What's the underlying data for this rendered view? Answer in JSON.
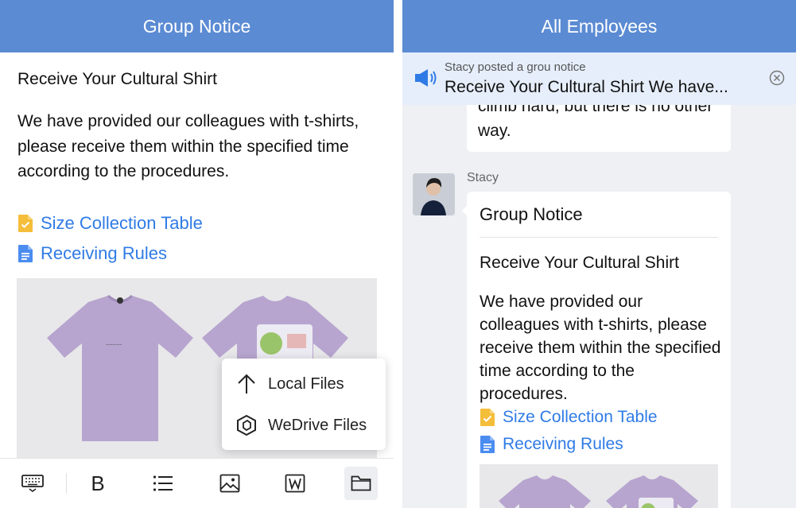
{
  "left": {
    "title": "Group Notice",
    "notice_title": "Receive Your Cultural Shirt",
    "notice_body": "We have provided our colleagues with t-shirts, please receive them within the specified time according to the procedures.",
    "links": [
      {
        "label": "Size Collection Table",
        "icon": "sheet-doc-icon"
      },
      {
        "label": "Receiving Rules",
        "icon": "text-doc-icon"
      }
    ],
    "upload_menu": {
      "items": [
        {
          "label": "Local Files",
          "icon": "upload-arrow-icon"
        },
        {
          "label": "WeDrive Files",
          "icon": "wedrive-icon"
        }
      ]
    },
    "toolbar": {
      "items": [
        "keyboard-icon",
        "bold-icon",
        "list-icon",
        "image-icon",
        "word-doc-icon",
        "folder-icon"
      ],
      "bold_label": "B",
      "active": "folder-icon"
    }
  },
  "right": {
    "title": "All Employees",
    "banner": {
      "meta": "Stacy posted a grou notice",
      "text": "Receive Your Cultural Shirt We have..."
    },
    "prev_message_text": "climb hard, but there is no other way.",
    "message": {
      "sender": "Stacy",
      "card_header": "Group Notice",
      "title": "Receive Your Cultural Shirt",
      "body": "We have provided our colleagues with t-shirts, please receive them within the specified time according to the procedures.",
      "links": [
        {
          "label": "Size Collection Table"
        },
        {
          "label": "Receiving Rules"
        }
      ]
    }
  },
  "colors": {
    "titlebar": "#5b8bd3",
    "link": "#2f7be6",
    "banner_bg": "#e6eefb",
    "chat_bg": "#eef0f3",
    "shirt": "#b7a5cf"
  }
}
